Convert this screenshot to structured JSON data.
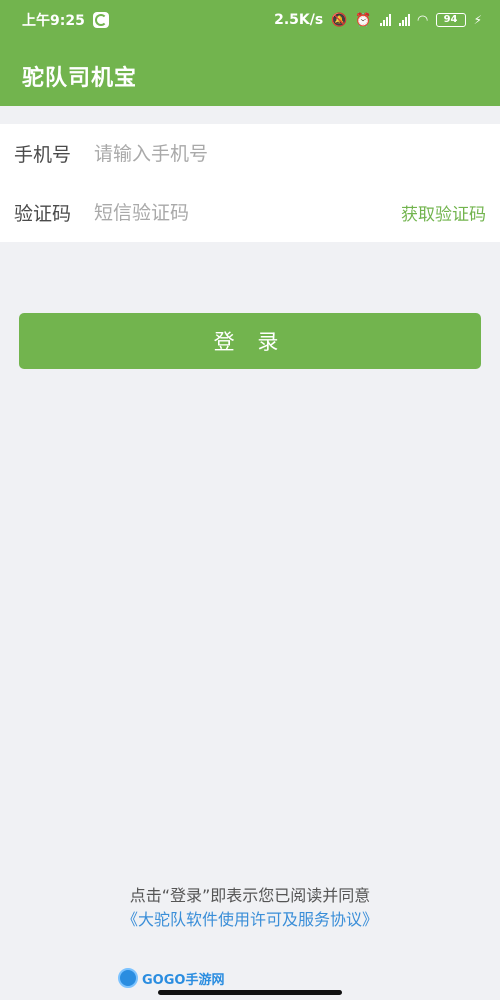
{
  "status_bar": {
    "time": "上午9:25",
    "net_speed": "2.5K/s",
    "battery_level": "94"
  },
  "app_bar": {
    "title": "驼队司机宝"
  },
  "form": {
    "phone": {
      "label": "手机号",
      "value": "",
      "placeholder": "请输入手机号"
    },
    "code": {
      "label": "验证码",
      "value": "",
      "placeholder": "短信验证码",
      "get_code_label": "获取验证码"
    }
  },
  "login_button": {
    "label": "登 录"
  },
  "agreement": {
    "text": "点击“登录”即表示您已阅读并同意",
    "link": "《大驼队软件使用许可及服务协议》"
  },
  "watermark": {
    "text": "GOGO手游网"
  },
  "colors": {
    "brand": "#72b44e",
    "link": "#3a8ed8",
    "background": "#f0f1f4"
  },
  "icons": [
    "app-notification-icon",
    "mute-icon",
    "alarm-icon",
    "signal-icon",
    "wifi-icon",
    "battery-icon",
    "charging-icon"
  ]
}
